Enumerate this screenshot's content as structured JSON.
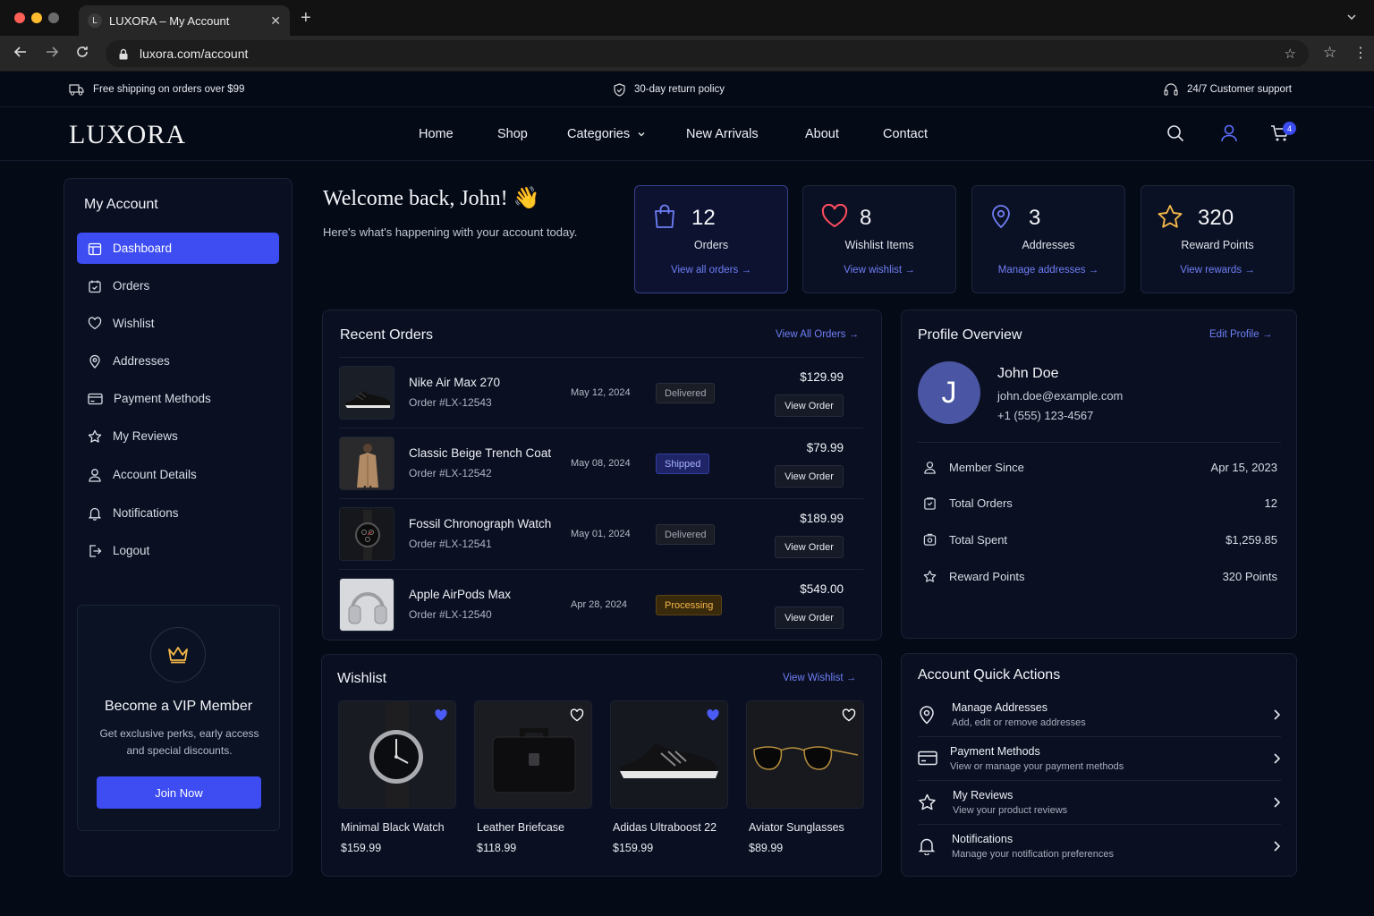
{
  "browser": {
    "tab_title": "LUXORA – My Account",
    "tab_favicon": "L",
    "url": "luxora.com/account"
  },
  "announce": {
    "shipping": "Free shipping on orders over $99",
    "returns": "30-day return policy",
    "support": "24/7 Customer support"
  },
  "header": {
    "logo": "LUXORA",
    "nav": [
      "Home",
      "Shop",
      "Categories",
      "New Arrivals",
      "About",
      "Contact"
    ],
    "cart_count": "4"
  },
  "sidebar": {
    "title": "My Account",
    "items": [
      {
        "label": "Dashboard",
        "icon": "dashboard-icon",
        "active": true
      },
      {
        "label": "Orders",
        "icon": "orders-icon"
      },
      {
        "label": "Wishlist",
        "icon": "heart-icon"
      },
      {
        "label": "Addresses",
        "icon": "pin-icon"
      },
      {
        "label": "Payment Methods",
        "icon": "card-icon"
      },
      {
        "label": "My Reviews",
        "icon": "star-icon"
      },
      {
        "label": "Account Details",
        "icon": "user-icon"
      },
      {
        "label": "Notifications",
        "icon": "bell-icon"
      },
      {
        "label": "Logout",
        "icon": "logout-icon"
      }
    ],
    "vip": {
      "title": "Become a VIP Member",
      "text": "Get exclusive perks, early access and special discounts.",
      "button": "Join Now"
    }
  },
  "welcome": {
    "title": "Welcome back, John! 👋",
    "subtitle": "Here's what's happening with your account today."
  },
  "stats": [
    {
      "value": "12",
      "label": "Orders",
      "link": "View all orders"
    },
    {
      "value": "8",
      "label": "Wishlist Items",
      "link": "View wishlist"
    },
    {
      "value": "3",
      "label": "Addresses",
      "link": "Manage addresses"
    },
    {
      "value": "320",
      "label": "Reward Points",
      "link": "View rewards"
    }
  ],
  "recent_orders": {
    "title": "Recent Orders",
    "link": "View All Orders",
    "button_label": "View Order",
    "rows": [
      {
        "name": "Nike Air Max 270",
        "number": "Order #LX-12543",
        "date": "May 12, 2024",
        "status": "Delivered",
        "price": "$129.99"
      },
      {
        "name": "Classic Beige Trench Coat",
        "number": "Order #LX-12542",
        "date": "May 08, 2024",
        "status": "Shipped",
        "price": "$79.99"
      },
      {
        "name": "Fossil Chronograph Watch",
        "number": "Order #LX-12541",
        "date": "May 01, 2024",
        "status": "Delivered",
        "price": "$189.99"
      },
      {
        "name": "Apple AirPods Max",
        "number": "Order #LX-12540",
        "date": "Apr 28, 2024",
        "status": "Processing",
        "price": "$549.00"
      }
    ]
  },
  "profile": {
    "title": "Profile Overview",
    "link": "Edit Profile",
    "initial": "J",
    "name": "John Doe",
    "email": "john.doe@example.com",
    "phone": "+1 (555) 123-4567",
    "rows": [
      {
        "label": "Member Since",
        "value": "Apr 15, 2023"
      },
      {
        "label": "Total Orders",
        "value": "12"
      },
      {
        "label": "Total Spent",
        "value": "$1,259.85"
      },
      {
        "label": "Reward Points",
        "value": "320 Points"
      }
    ]
  },
  "wishlist": {
    "title": "Wishlist",
    "link": "View Wishlist",
    "items": [
      {
        "name": "Minimal Black Watch",
        "price": "$159.99",
        "favorited": true
      },
      {
        "name": "Leather Briefcase",
        "price": "$118.99",
        "favorited": false
      },
      {
        "name": "Adidas Ultraboost 22",
        "price": "$159.99",
        "favorited": true
      },
      {
        "name": "Aviator Sunglasses",
        "price": "$89.99",
        "favorited": false
      }
    ]
  },
  "quick_actions": {
    "title": "Account Quick Actions",
    "items": [
      {
        "title": "Manage Addresses",
        "subtitle": "Add, edit or remove addresses"
      },
      {
        "title": "Payment Methods",
        "subtitle": "View or manage your payment methods"
      },
      {
        "title": "My Reviews",
        "subtitle": "View your product reviews"
      },
      {
        "title": "Notifications",
        "subtitle": "Manage your notification preferences"
      }
    ]
  },
  "colors": {
    "accent": "#3d4df2",
    "link": "#6f7ef6",
    "background": "#050a17",
    "gold": "#f3b749"
  }
}
